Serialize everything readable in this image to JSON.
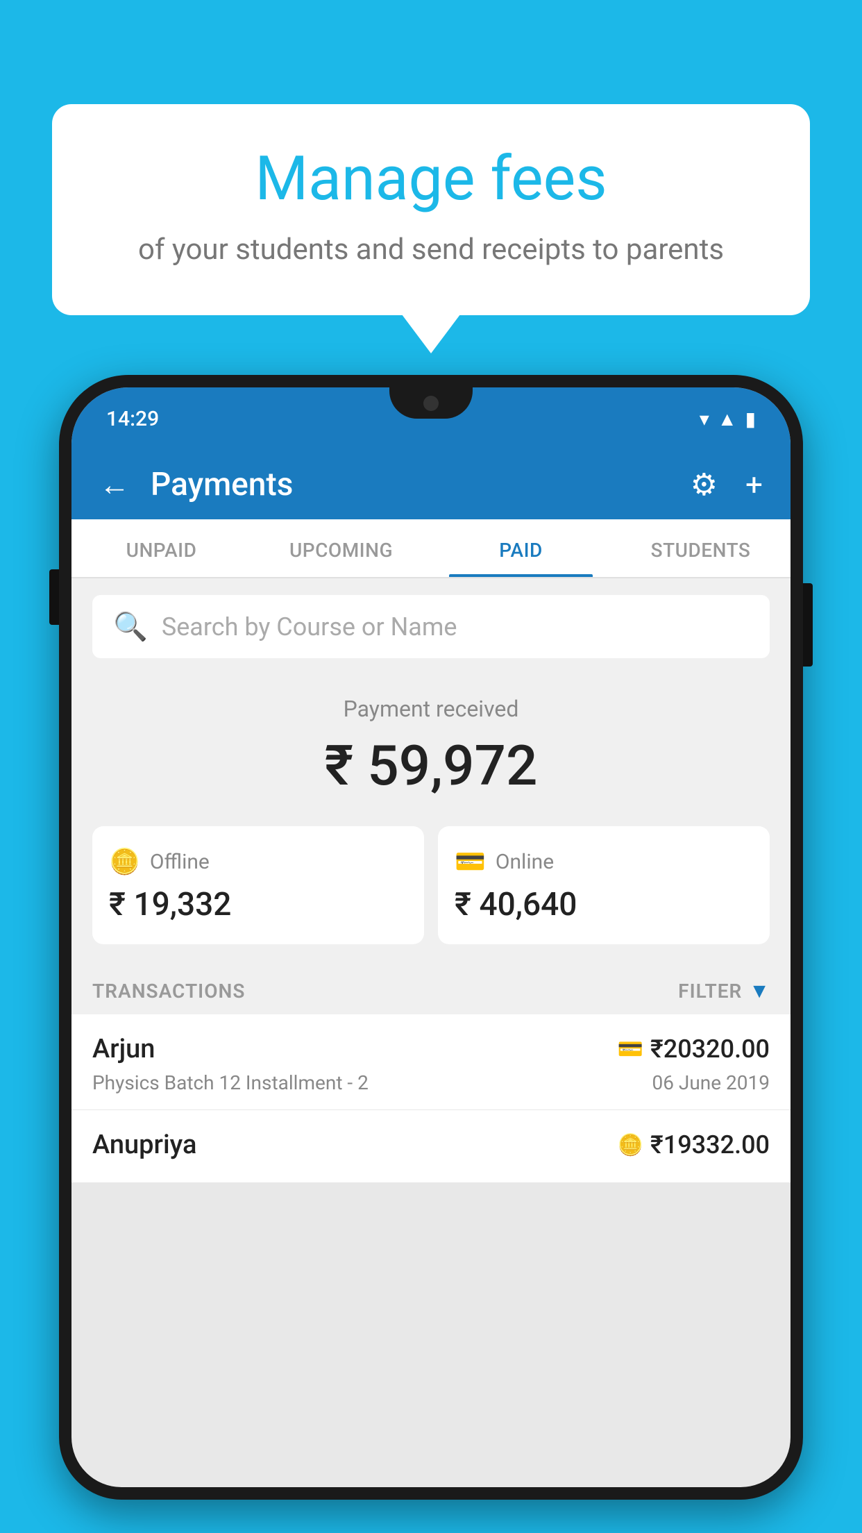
{
  "background": {
    "color": "#1cb8e8"
  },
  "bubble": {
    "title": "Manage fees",
    "subtitle": "of your students and send receipts to parents"
  },
  "phone": {
    "status_bar": {
      "time": "14:29"
    },
    "header": {
      "title": "Payments",
      "back_label": "←",
      "gear_label": "⚙",
      "plus_label": "+"
    },
    "tabs": [
      {
        "id": "unpaid",
        "label": "UNPAID",
        "active": false
      },
      {
        "id": "upcoming",
        "label": "UPCOMING",
        "active": false
      },
      {
        "id": "paid",
        "label": "PAID",
        "active": true
      },
      {
        "id": "students",
        "label": "STUDENTS",
        "active": false
      }
    ],
    "search": {
      "placeholder": "Search by Course or Name"
    },
    "payment_summary": {
      "label": "Payment received",
      "amount": "₹ 59,972",
      "offline": {
        "label": "Offline",
        "amount": "₹ 19,332"
      },
      "online": {
        "label": "Online",
        "amount": "₹ 40,640"
      }
    },
    "transactions": {
      "header_label": "TRANSACTIONS",
      "filter_label": "FILTER",
      "rows": [
        {
          "name": "Arjun",
          "course": "Physics Batch 12 Installment - 2",
          "amount": "₹20320.00",
          "date": "06 June 2019",
          "type": "online"
        },
        {
          "name": "Anupriya",
          "amount": "₹19332.00",
          "type": "offline",
          "partial": true
        }
      ]
    }
  }
}
